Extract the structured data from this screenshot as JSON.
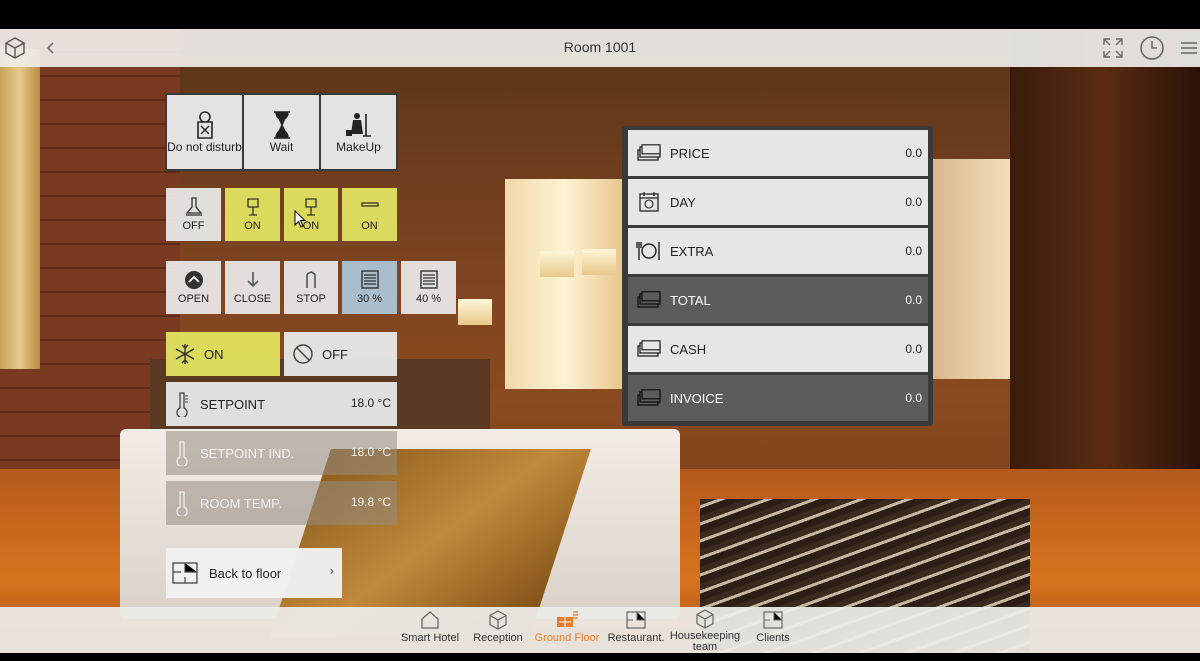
{
  "header": {
    "title": "Room 1001"
  },
  "services": [
    {
      "label": "Do not disturb",
      "icon": "do-not-disturb-icon"
    },
    {
      "label": "Wait",
      "icon": "hourglass-icon"
    },
    {
      "label": "MakeUp",
      "icon": "housekeeper-icon"
    }
  ],
  "lights": [
    {
      "label": "OFF",
      "state": "off",
      "icon": "ceiling-lamp-icon"
    },
    {
      "label": "ON",
      "state": "on",
      "icon": "table-lamp-icon"
    },
    {
      "label": "ON",
      "state": "on",
      "icon": "table-lamp-icon"
    },
    {
      "label": "ON",
      "state": "on",
      "icon": "strip-light-icon"
    }
  ],
  "blinds": [
    {
      "label": "OPEN",
      "icon": "open-icon"
    },
    {
      "label": "CLOSE",
      "icon": "close-arrow-icon"
    },
    {
      "label": "STOP",
      "icon": "stop-icon"
    },
    {
      "label": "30 %",
      "icon": "blind-icon"
    },
    {
      "label": "40 %",
      "icon": "blind-icon"
    }
  ],
  "hvac": {
    "on_label": "ON",
    "off_label": "OFF",
    "setpoint_label": "SETPOINT",
    "setpoint_value": "18.0 °C",
    "setpoint_ind_label": "SETPOINT IND.",
    "setpoint_ind_value": "18.0 °C",
    "room_temp_label": "ROOM TEMP.",
    "room_temp_value": "19.8 °C"
  },
  "back": {
    "label": "Back to floor",
    "chevron": "›"
  },
  "billing": [
    {
      "label": "PRICE",
      "value": "0.0",
      "icon": "money-icon",
      "style": "light"
    },
    {
      "label": "DAY",
      "value": "0.0",
      "icon": "calendar-icon",
      "style": "light"
    },
    {
      "label": "EXTRA",
      "value": "0.0",
      "icon": "cutlery-icon",
      "style": "light"
    },
    {
      "label": "TOTAL",
      "value": "0.0",
      "icon": "money-icon",
      "style": "dark"
    },
    {
      "label": "CASH",
      "value": "0.0",
      "icon": "money-icon",
      "style": "light"
    },
    {
      "label": "INVOICE",
      "value": "0.0",
      "icon": "money-icon",
      "style": "dark"
    }
  ],
  "nav": [
    {
      "label": "Smart Hotel",
      "icon": "home-icon",
      "active": false
    },
    {
      "label": "Reception",
      "icon": "cube-icon",
      "active": false
    },
    {
      "label": "Ground Floor",
      "icon": "floor-icon",
      "active": true
    },
    {
      "label": "Restaurant.",
      "icon": "floorplan-icon",
      "active": false
    },
    {
      "label": "Housekeeping team",
      "icon": "cube-icon",
      "active": false
    },
    {
      "label": "Clients",
      "icon": "floorplan-icon",
      "active": false
    }
  ],
  "colors": {
    "accent_yellow": "#e2e360",
    "active_nav": "#e87c2a",
    "blue_tile": "#acc4d6"
  }
}
